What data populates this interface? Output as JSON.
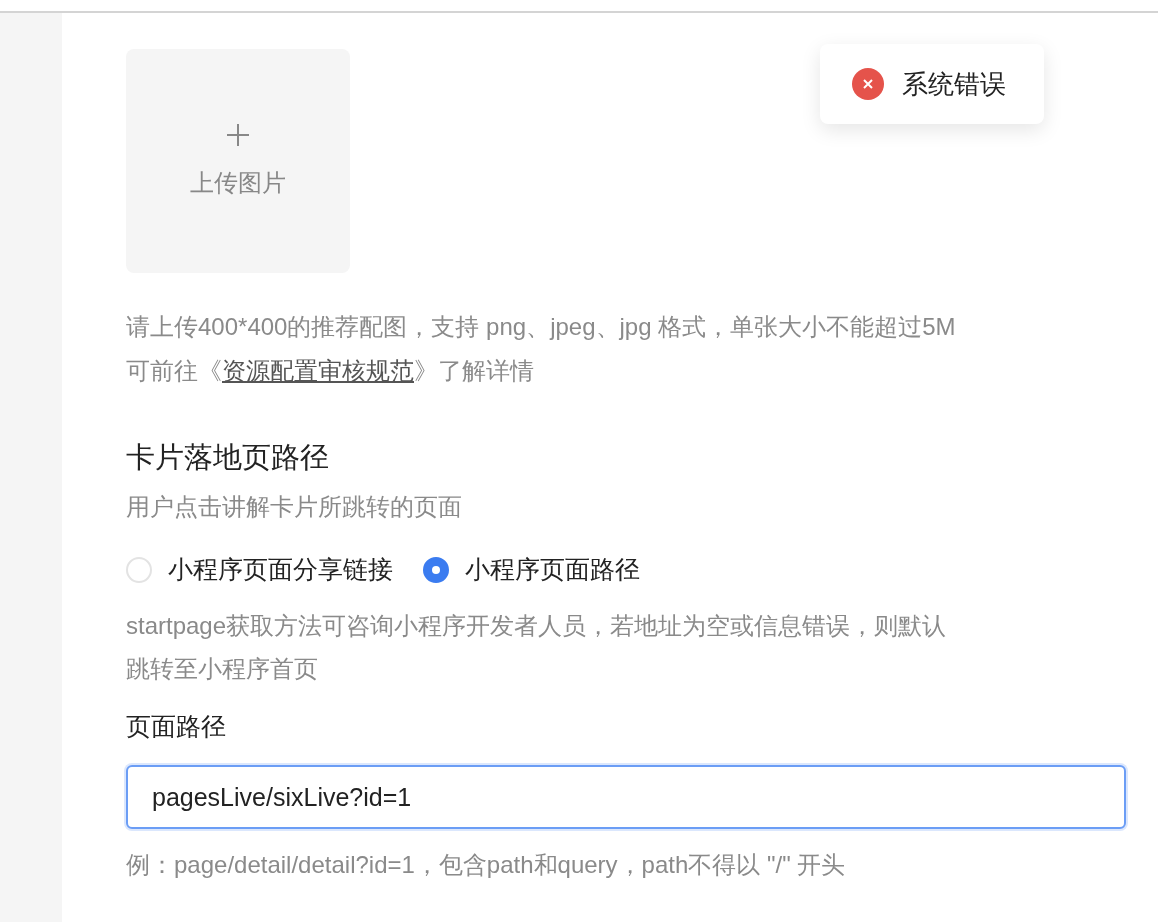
{
  "upload": {
    "label": "上传图片"
  },
  "upload_help": {
    "text": "请上传400*400的推荐配图，支持 png、jpeg、jpg 格式，单张大小不能超过5M",
    "link_prefix": "可前往《",
    "link": "资源配置审核规范",
    "link_suffix": "》了解详情"
  },
  "landing": {
    "title": "卡片落地页路径",
    "description": "用户点击讲解卡片所跳转的页面",
    "options": [
      {
        "label": "小程序页面分享链接",
        "selected": false
      },
      {
        "label": "小程序页面路径",
        "selected": true
      }
    ],
    "note": "startpage获取方法可咨询小程序开发者人员，若地址为空或信息错误，则默认跳转至小程序首页",
    "field_label": "页面路径",
    "field_value": "pagesLive/sixLive?id=1",
    "field_focused": true,
    "example": "例：page/detail/detail?id=1，包含path和query，path不得以 \"/\" 开头"
  },
  "toast": {
    "kind": "error",
    "message": "系统错误"
  }
}
